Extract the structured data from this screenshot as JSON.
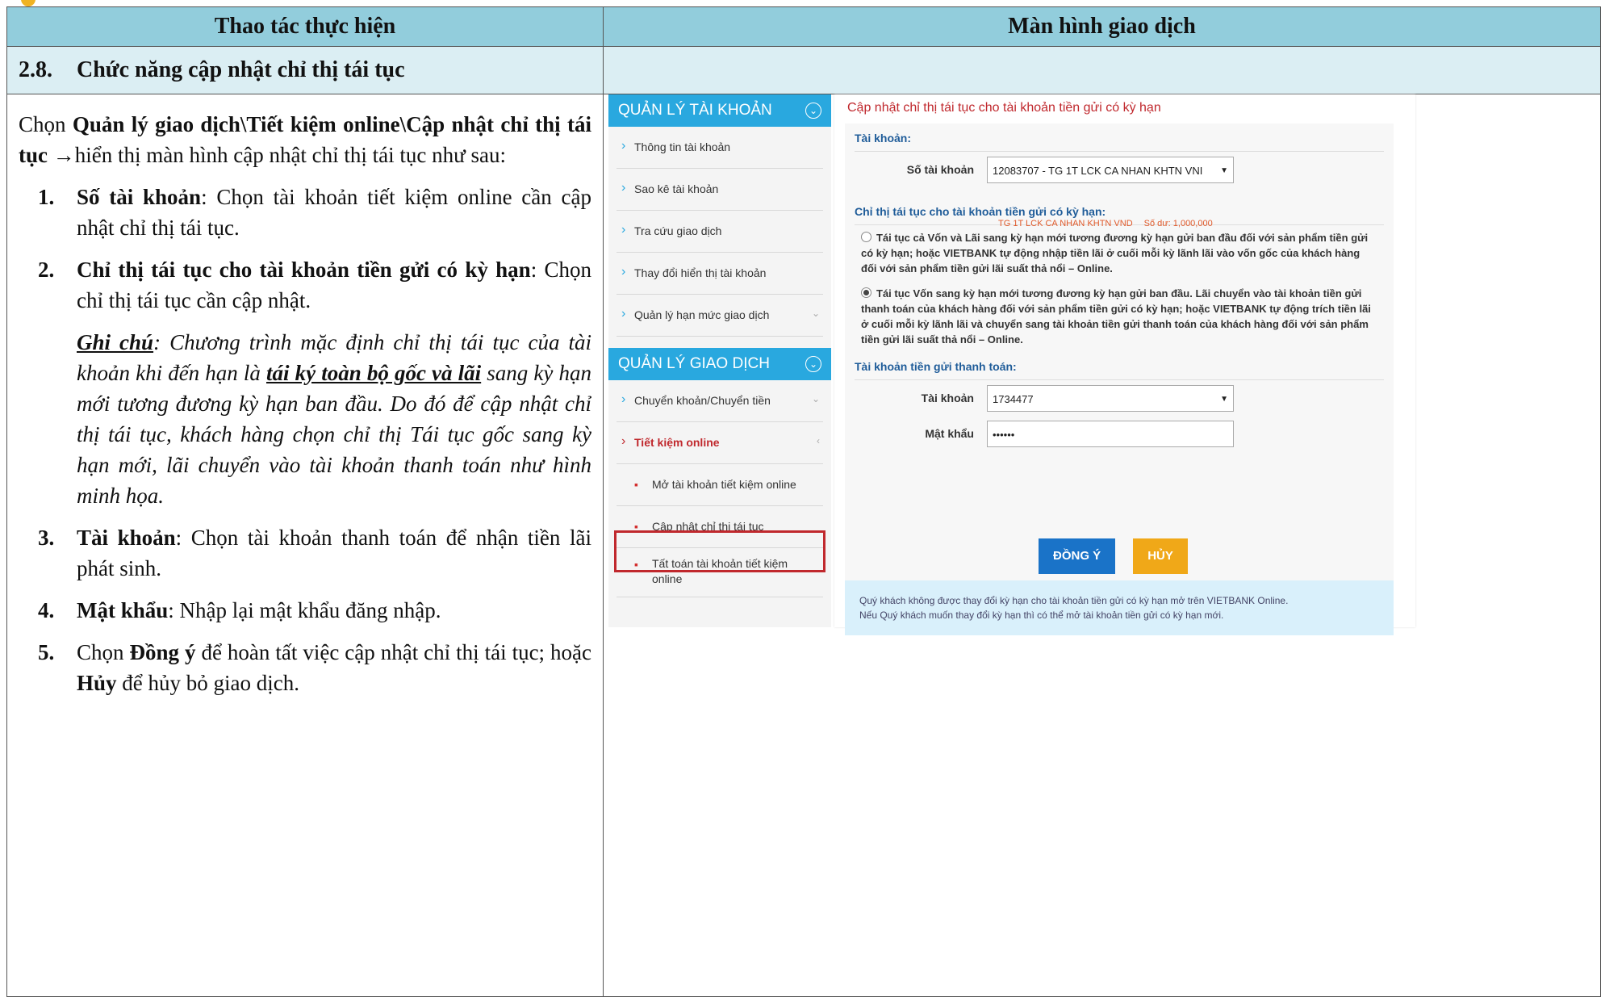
{
  "header": {
    "left": "Thao tác thực hiện",
    "right": "Màn hình giao dịch"
  },
  "section": {
    "number": "2.8.",
    "title": "Chức năng cập nhật chỉ thị tái tục"
  },
  "intro": {
    "prefix": "Chọn ",
    "path": "Quản lý giao dịch\\Tiết kiệm online\\Cập nhật chỉ thị tái tục",
    "arrow": "→",
    "suffix": "hiển thị màn hình cập nhật chỉ thị tái tục như sau:"
  },
  "steps": [
    {
      "n": "1.",
      "term": "Số tài khoản",
      "text": ": Chọn tài khoản tiết kiệm online cần cập nhật chỉ thị tái tục."
    },
    {
      "n": "2.",
      "term": "Chỉ thị tái tục cho tài khoản tiền gửi có kỳ hạn",
      "text": ": Chọn chỉ thị tái tục cần cập nhật."
    },
    {
      "n": "3.",
      "term": "Tài khoản",
      "text": ": Chọn tài khoản thanh toán để nhận tiền lãi phát sinh."
    },
    {
      "n": "4.",
      "term": "Mật khẩu",
      "text": ": Nhập lại mật khẩu đăng nhập."
    }
  ],
  "note": {
    "label": "Ghi chú",
    "t1": ": Chương trình mặc định chỉ thị tái tục của tài khoản khi đến hạn là ",
    "emph": "tái ký toàn bộ gốc và lãi",
    "t2": " sang kỳ hạn mới tương đương kỳ hạn ban đầu. Do đó để cập nhật chỉ thị tái tục, khách hàng chọn chỉ thị Tái tục gốc sang kỳ hạn mới, lãi chuyển vào tài khoản thanh toán như hình minh họa."
  },
  "step5": {
    "n": "5.",
    "pre": "Chọn ",
    "ok": "Đồng ý",
    "mid": " để hoàn tất việc cập nhật chỉ thị tái tục; hoặc ",
    "cancel": "Hủy",
    "post": " để hủy bỏ giao dịch."
  },
  "screen": {
    "sidebar": {
      "account_header": "QUẢN LÝ TÀI KHOẢN",
      "account_items": [
        "Thông tin tài khoản",
        "Sao kê tài khoản",
        "Tra cứu giao dịch",
        "Thay đổi hiển thị tài khoản",
        "Quản lý hạn mức giao dịch"
      ],
      "txn_header": "QUẢN LÝ GIAO DỊCH",
      "txn_items": [
        "Chuyển khoản/Chuyển tiền",
        "Tiết kiệm online"
      ],
      "savings_sub": [
        "Mở tài khoản tiết kiệm online",
        "Cập nhật chỉ thị tái tục",
        "Tất toán tài khoản tiết kiệm online"
      ]
    },
    "title": "Cập nhật chỉ thị tái tục cho tài khoản tiền gửi có kỳ hạn",
    "account_group": "Tài khoản:",
    "account_label": "Số tài khoản",
    "account_value": "12083707 - TG 1T LCK CA NHAN KHTN VNI",
    "account_name": "TG 1T LCK CA NHAN KHTN VND",
    "account_balance": "Số dư: 1,000,000",
    "instruction_group": "Chỉ thị tái tục cho tài khoản tiền gửi có kỳ hạn:",
    "option1": "Tái tục cả Vốn và Lãi sang kỳ hạn mới tương đương kỳ hạn gửi ban đầu đối với sản phẩm tiền gửi có kỳ hạn; hoặc VIETBANK tự động nhập tiền lãi ở cuối mỗi kỳ lãnh lãi vào vốn gốc của khách hàng đối với sản phẩm tiền gửi lãi suất thả nổi – Online.",
    "option2": "Tái tục Vốn sang kỳ hạn mới tương đương kỳ hạn gửi ban đầu. Lãi chuyển vào tài khoản tiền gửi thanh toán của khách hàng đối với sản phẩm tiền gửi có kỳ hạn; hoặc VIETBANK tự động trích tiền lãi ở cuối mỗi kỳ lãnh lãi và chuyển sang tài khoản tiền gửi thanh toán của khách hàng đối với sản phẩm tiền gửi lãi suất thả nổi – Online.",
    "payment_group": "Tài khoản tiền gửi thanh toán:",
    "pay_label": "Tài khoản",
    "pay_value": "1734477",
    "pwd_label": "Mật khẩu",
    "pwd_value": "••••••",
    "btn_ok": "ĐỒNG Ý",
    "btn_cancel": "HỦY",
    "info1": "Quý khách không được thay đổi kỳ hạn cho tài khoản tiền gửi có kỳ hạn mở trên VIETBANK Online.",
    "info2": "Nếu Quý khách muốn thay đổi kỳ hạn thì có thể mở tài khoản tiền gửi có kỳ hạn mới."
  }
}
